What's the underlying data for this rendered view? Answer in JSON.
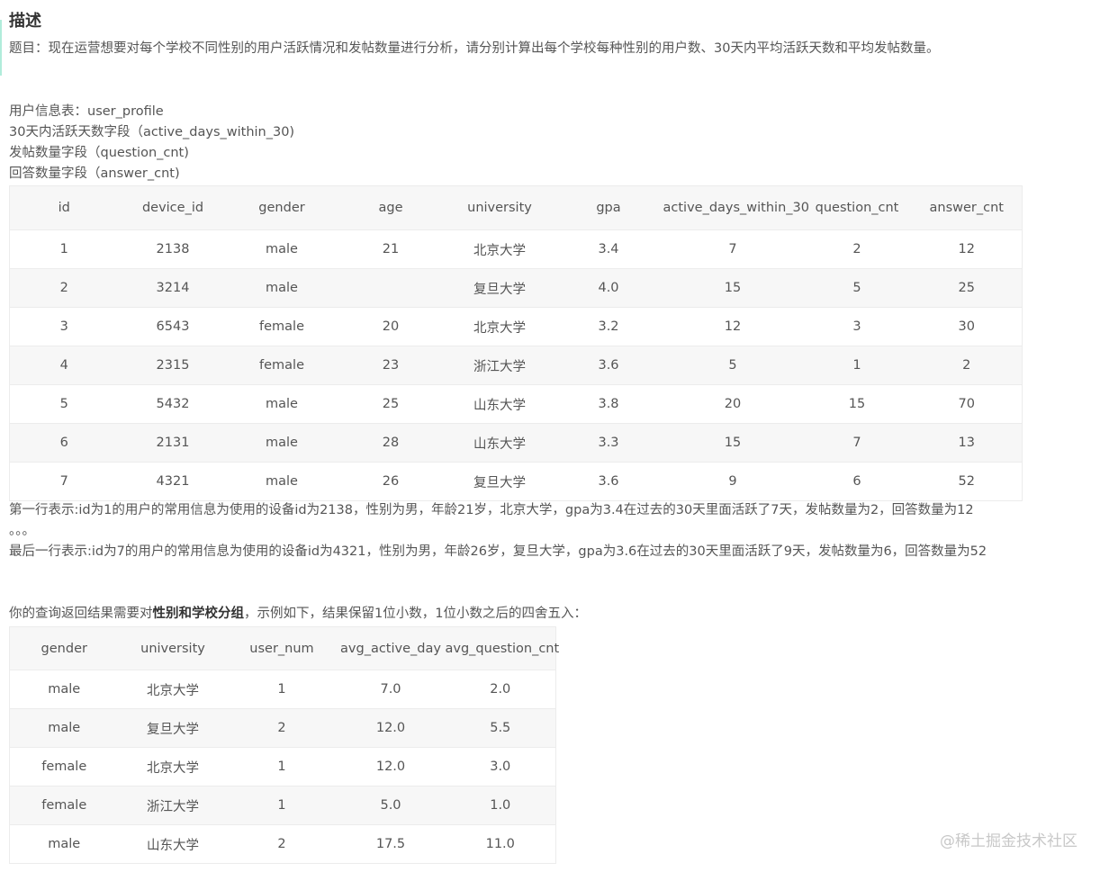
{
  "title": "描述",
  "question": "题目：现在运营想要对每个学校不同性别的用户活跃情况和发帖数量进行分析，请分别计算出每个学校每种性别的用户数、30天内平均活跃天数和平均发帖数量。",
  "table_info": [
    "用户信息表：user_profile",
    "30天内活跃天数字段（active_days_within_30)",
    "发帖数量字段（question_cnt)",
    "回答数量字段（answer_cnt)"
  ],
  "user_table": {
    "headers": [
      "id",
      "device_id",
      "gender",
      "age",
      "university",
      "gpa",
      "active_days_within_30",
      "question_cnt",
      "answer_cnt"
    ],
    "rows": [
      [
        "1",
        "2138",
        "male",
        "21",
        "北京大学",
        "3.4",
        "7",
        "2",
        "12"
      ],
      [
        "2",
        "3214",
        "male",
        "",
        "复旦大学",
        "4.0",
        "15",
        "5",
        "25"
      ],
      [
        "3",
        "6543",
        "female",
        "20",
        "北京大学",
        "3.2",
        "12",
        "3",
        "30"
      ],
      [
        "4",
        "2315",
        "female",
        "23",
        "浙江大学",
        "3.6",
        "5",
        "1",
        "2"
      ],
      [
        "5",
        "5432",
        "male",
        "25",
        "山东大学",
        "3.8",
        "20",
        "15",
        "70"
      ],
      [
        "6",
        "2131",
        "male",
        "28",
        "山东大学",
        "3.3",
        "15",
        "7",
        "13"
      ],
      [
        "7",
        "4321",
        "male",
        "26",
        "复旦大学",
        "3.6",
        "9",
        "6",
        "52"
      ]
    ]
  },
  "notes": {
    "first_row": "第一行表示:id为1的用户的常用信息为使用的设备id为2138，性别为男，年龄21岁，北京大学，gpa为3.4在过去的30天里面活跃了7天，发帖数量为2，回答数量为12",
    "ellipsis": "。。。",
    "last_row": "最后一行表示:id为7的用户的常用信息为使用的设备id为4321，性别为男，年龄26岁，复旦大学，gpa为3.6在过去的30天里面活跃了9天，发帖数量为6，回答数量为52"
  },
  "result_desc": {
    "prefix": "你的查询返回结果需要对",
    "bold": "性别和学校分组",
    "suffix": "，示例如下，结果保留1位小数，1位小数之后的四舍五入："
  },
  "result_table": {
    "headers": [
      "gender",
      "university",
      "user_num",
      "avg_active_day",
      "avg_question_cnt"
    ],
    "rows": [
      [
        "male",
        "北京大学",
        "1",
        "7.0",
        "2.0"
      ],
      [
        "male",
        "复旦大学",
        "2",
        "12.0",
        "5.5"
      ],
      [
        "female",
        "北京大学",
        "1",
        "12.0",
        "3.0"
      ],
      [
        "female",
        "浙江大学",
        "1",
        "5.0",
        "1.0"
      ],
      [
        "male",
        "山东大学",
        "2",
        "17.5",
        "11.0"
      ]
    ]
  },
  "watermark": "@稀土掘金技术社区"
}
